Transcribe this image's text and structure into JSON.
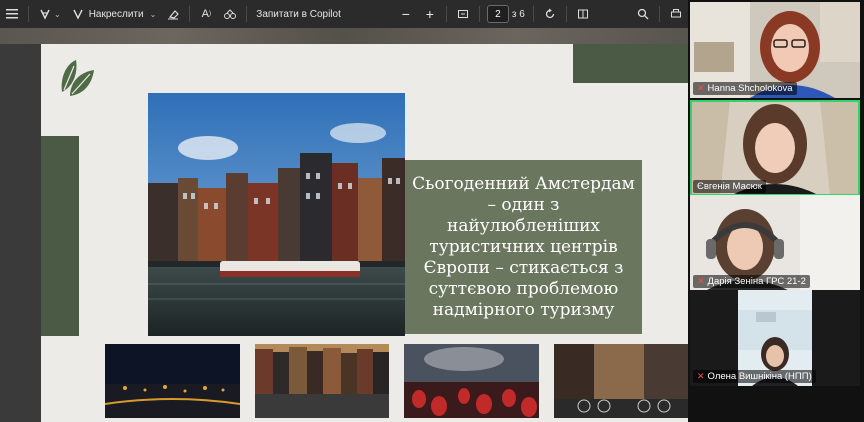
{
  "toolbar": {
    "draw_label": "Накреслити",
    "copilot_label": "Запитати в Copilot",
    "page_current": "2",
    "page_total": "з 6"
  },
  "slide": {
    "title": "Сьогоденний Амстердам – один з найулюбленіших туристичних центрів Європи – стикається з суттєвою проблемою надмірного туризму"
  },
  "participants": [
    {
      "name": "Hanna Shcholokova",
      "muted": true,
      "active": false
    },
    {
      "name": "Євгенія Масюк",
      "muted": false,
      "active": true
    },
    {
      "name": "Дарія Зеніна ГРС 21-2",
      "muted": true,
      "active": false
    },
    {
      "name": "Олена Вишнікіна (НПП)",
      "muted": true,
      "active": false
    }
  ],
  "colors": {
    "slide_green": "#4b5a44",
    "title_box": "#6b765e",
    "active_speaker": "#2fd56a"
  }
}
